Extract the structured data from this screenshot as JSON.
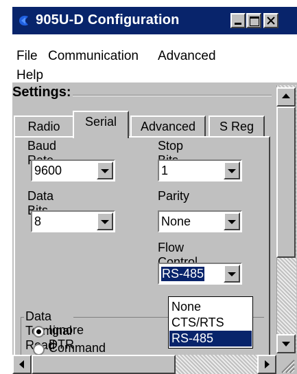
{
  "window": {
    "title": "905U-D Configuration"
  },
  "menu": {
    "file": "File",
    "communication": "Communication",
    "advanced": "Advanced",
    "help": "Help"
  },
  "settings_group": "Settings:",
  "tabs": [
    {
      "label": "Radio",
      "active": false
    },
    {
      "label": "Serial",
      "active": true
    },
    {
      "label": "Advanced",
      "active": false
    },
    {
      "label": "S Reg",
      "active": false
    }
  ],
  "fields": {
    "baud_rate": {
      "label": "Baud Rate",
      "value": "9600"
    },
    "stop_bits": {
      "label": "Stop Bits",
      "value": "1"
    },
    "data_bits": {
      "label": "Data Bits",
      "value": "8"
    },
    "parity": {
      "label": "Parity",
      "value": "None"
    },
    "flow_control": {
      "label": "Flow Control",
      "value": "RS-485",
      "options": [
        "None",
        "CTS/RTS",
        "RS-485"
      ]
    }
  },
  "dtr_group": {
    "title": "Data Terminal Read",
    "options": [
      "Ignore DTR",
      "Command Mode"
    ],
    "selected": "Ignore DTR"
  },
  "colors": {
    "titlebar": "#08246b",
    "face": "#c0c0c0",
    "selection": "#08246b"
  },
  "icons": {
    "app": "app-icon",
    "minimize": "minimize-icon",
    "maximize": "maximize-icon",
    "close": "close-icon"
  }
}
